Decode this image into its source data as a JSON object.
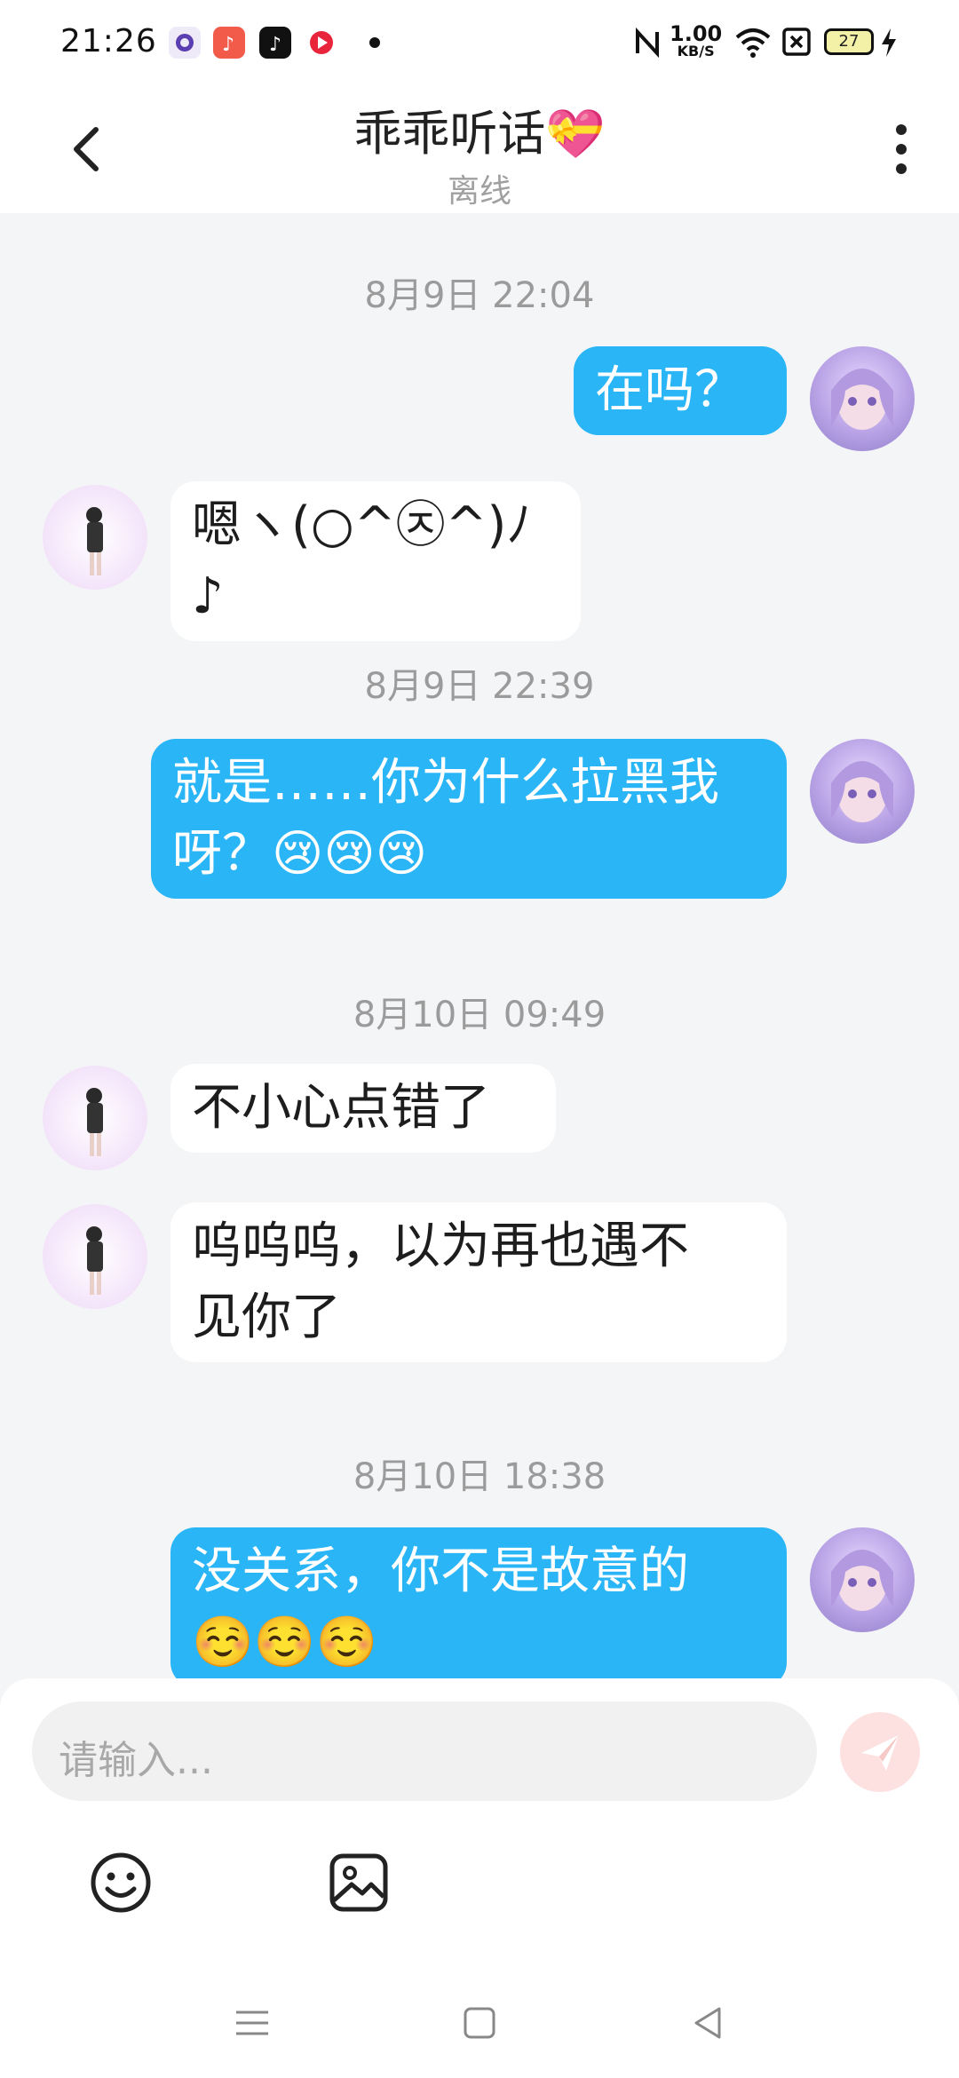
{
  "status_bar": {
    "time": "21:26",
    "speed_value": "1.00",
    "speed_unit": "KB/S",
    "battery": "27"
  },
  "header": {
    "title": "乖乖听话💝",
    "subtitle": "离线"
  },
  "messages": [
    {
      "timestamp": "8月9日 22:04"
    },
    {
      "from": "me",
      "text": "在吗？"
    },
    {
      "from": "other",
      "text": "嗯ヽ(○^㉨^)ﾉ♪"
    },
    {
      "timestamp": "8月9日 22:39"
    },
    {
      "from": "me",
      "line1": "就是……你为什么拉黑我",
      "line2": "呀？😢😢😢"
    },
    {
      "timestamp": "8月10日 09:49"
    },
    {
      "from": "other",
      "text": "不小心点错了"
    },
    {
      "from": "other",
      "line1": "呜呜呜，以为再也遇不",
      "line2": "见你了"
    },
    {
      "timestamp": "8月10日 18:38"
    },
    {
      "from": "me",
      "line1": "没关系，你不是故意的",
      "line2": "☺️☺️☺️"
    }
  ],
  "input": {
    "placeholder": "请输入..."
  },
  "icons": {
    "back": "chevron-left-icon",
    "more": "more-vertical-icon",
    "send": "send-icon",
    "emoji": "emoji-icon",
    "image": "image-icon"
  },
  "colors": {
    "my_bubble": "#29b5f6",
    "other_bubble": "#ffffff",
    "background": "#f4f5f7",
    "send_disabled": "#fde1e1"
  }
}
